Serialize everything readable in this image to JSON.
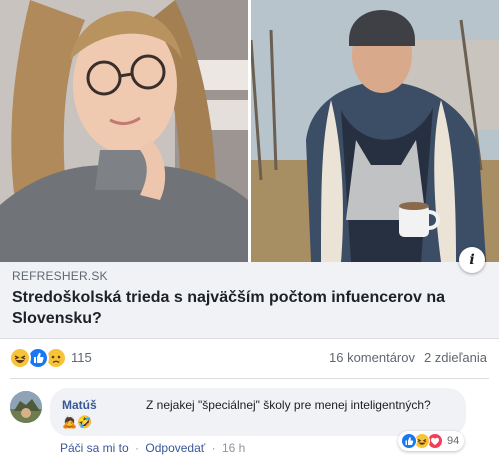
{
  "post": {
    "link": {
      "domain": "REFRESHER.SK",
      "title": "Stredoškolská trieda s najväčším počtom infuencerov na Slovensku?"
    },
    "reactions": {
      "icons": [
        "haha-reaction-icon",
        "like-reaction-icon",
        "sad-reaction-icon"
      ],
      "count": "115",
      "comments": "16 komentárov",
      "shares": "2 zdieľania"
    }
  },
  "comment": {
    "author": "Matúš",
    "text": "Z nejakej \"špeciálnej\" školy pre menej inteligentných?",
    "emoji": "🙇🤣",
    "reaction_icons": [
      "like-reaction-icon",
      "haha-reaction-icon",
      "love-reaction-icon"
    ],
    "reaction_count": "94",
    "actions": {
      "like": "Páči sa mi to",
      "separator": "·",
      "reply": "Odpovedať",
      "time": "16 h"
    }
  },
  "colors": {
    "link_name": "#385898",
    "like_blue": "#1877f2",
    "haha_yellow": "#f7c339",
    "love_red": "#f33e58",
    "preview_bg": "#f0f2f5"
  }
}
